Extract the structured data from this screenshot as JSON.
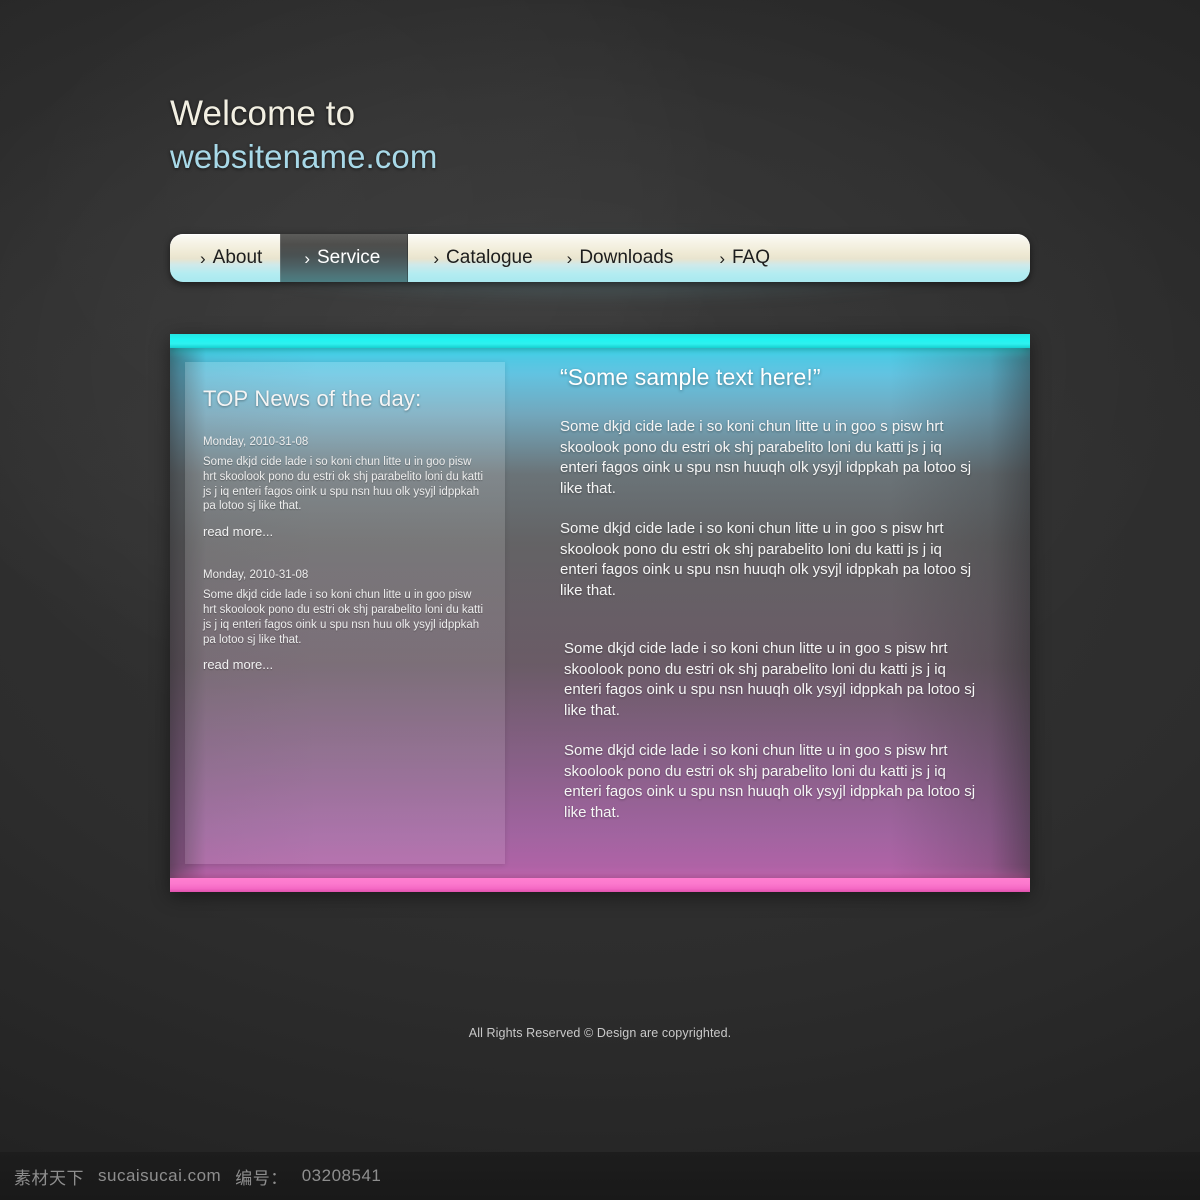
{
  "header": {
    "line1": "Welcome to",
    "line2": "websitename.com"
  },
  "nav": {
    "items": [
      {
        "label": "About",
        "chevron": "›",
        "active": false
      },
      {
        "label": "Service",
        "chevron": "›",
        "active": true
      },
      {
        "label": "Catalogue",
        "chevron": "›",
        "active": false
      },
      {
        "label": "Downloads",
        "chevron": "›",
        "active": false
      },
      {
        "label": "FAQ",
        "chevron": "›",
        "active": false
      }
    ]
  },
  "news": {
    "title": "TOP News of the day:",
    "read_more": "read more...",
    "items": [
      {
        "date": "Monday, 2010-31-08",
        "body": "Some dkjd  cide lade i so koni chun litte u in goo pisw hrt skoolook pono du estri ok shj parabelito loni du katti js j iq enteri fagos oink u spu nsn huu olk ysyjl idppkah pa lotoo sj like that.",
        "read_more": "read more..."
      },
      {
        "date": "Monday, 2010-31-08",
        "body": "Some dkjd  cide lade i so koni chun litte u in goo pisw hrt skoolook pono du estri ok shj parabelito loni du katti js j iq enteri fagos oink u spu nsn huu olk ysyjl idppkah pa lotoo sj like that.",
        "read_more": "read more..."
      }
    ]
  },
  "main": {
    "heading": "“Some sample text here!”",
    "paragraphs": [
      "Some dkjd  cide lade i so koni chun litte u in goo s pisw hrt skoolook pono du estri ok shj parabelito loni du katti js j iq enteri fagos oink u spu nsn huuqh olk ysyjl idppkah pa lotoo sj like that.",
      "Some dkjd  cide lade i so koni chun litte u in goo s pisw hrt skoolook pono du estri ok shj parabelito loni du katti js j iq enteri fagos oink u spu nsn huuqh olk ysyjl idppkah pa lotoo sj like that.",
      "Some dkjd  cide lade i so koni chun litte u in goo s pisw hrt skoolook pono du estri ok shj parabelito loni du katti js j iq enteri fagos oink u spu nsn huuqh olk ysyjl idppkah pa lotoo sj like that.",
      "Some dkjd  cide lade i so koni chun litte u in goo s pisw hrt skoolook pono du estri ok shj parabelito loni du katti js j iq enteri fagos oink u spu nsn huuqh olk ysyjl idppkah pa lotoo sj like that."
    ]
  },
  "footer": {
    "text": "All Rights Reserved ©  Design are copyrighted."
  },
  "watermark": {
    "site_cn": "素材天下",
    "site_url": "sucaisucai.com",
    "id_label": "编号：",
    "id_value": "03208541"
  },
  "colors": {
    "accent_cyan": "#22ecf0",
    "accent_pink": "#ff7fd0",
    "title_cream": "#f2efe2",
    "title_blue": "#a8d9e8",
    "background": "#2b2b2b"
  }
}
